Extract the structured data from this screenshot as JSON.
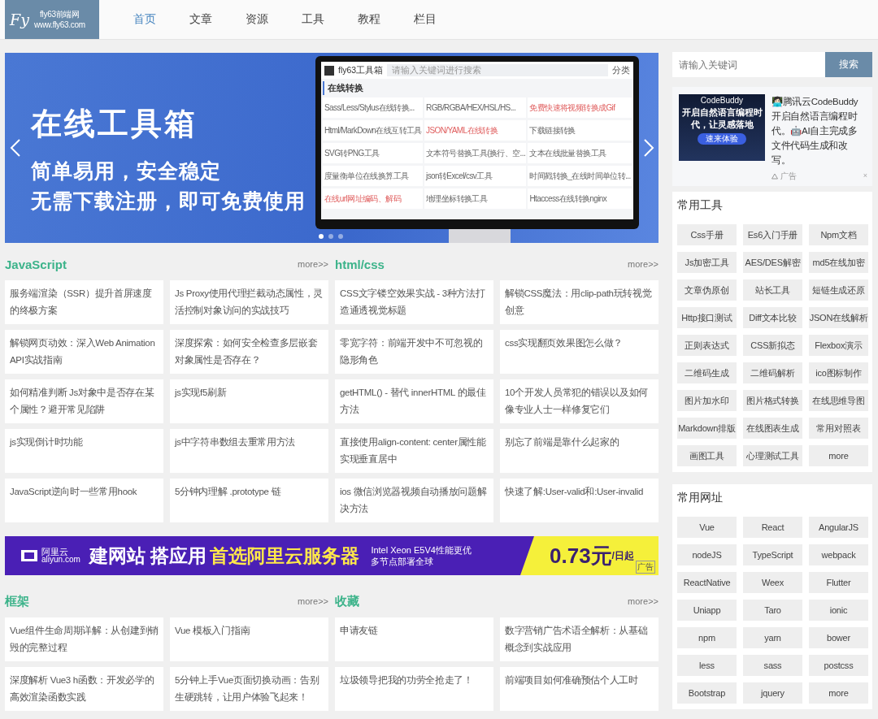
{
  "header": {
    "logo": {
      "mark": "Fy",
      "name": "fly63前端网",
      "url": "www.fly63.com"
    },
    "nav": [
      {
        "label": "首页",
        "selected": true
      },
      {
        "label": "文章",
        "selected": false
      },
      {
        "label": "资源",
        "selected": false
      },
      {
        "label": "工具",
        "selected": false
      },
      {
        "label": "教程",
        "selected": false
      },
      {
        "label": "栏目",
        "selected": false
      }
    ]
  },
  "banner": {
    "title": "在线工具箱",
    "lines": [
      "简单易用，安全稳定",
      "无需下载注册，即可免费使用"
    ],
    "screen": {
      "app_name": "fly63工具箱",
      "search_placeholder": "请输入关键词进行搜索",
      "category": "分类",
      "section": "在线转换",
      "items": [
        {
          "label": "Sass/Less/Stylus在线转换...",
          "hot": false
        },
        {
          "label": "RGB/RGBA/HEX/HSL/HS...",
          "hot": false
        },
        {
          "label": "免费快速将视频转换成Gif",
          "hot": true
        },
        {
          "label": "Html/MarkDown在线互转工具",
          "hot": false
        },
        {
          "label": "JSON/YAML在线转换",
          "hot": true
        },
        {
          "label": "下载链接转换",
          "hot": false
        },
        {
          "label": "SVG转PNG工具",
          "hot": false
        },
        {
          "label": "文本符号替换工具(换行、空...",
          "hot": false
        },
        {
          "label": "文本在线批量替换工具",
          "hot": false
        },
        {
          "label": "度量衡单位在线换算工具",
          "hot": false
        },
        {
          "label": "json转Excel/csv工具",
          "hot": false
        },
        {
          "label": "时间戳转换_在线时间单位转...",
          "hot": false
        },
        {
          "label": "在线url网址编码、解码",
          "hot": true
        },
        {
          "label": "地理坐标转换工具",
          "hot": false
        },
        {
          "label": "Htaccess在线转换nginx",
          "hot": false
        }
      ]
    },
    "dots": [
      {
        "selected": true
      },
      {
        "selected": false
      },
      {
        "selected": false
      }
    ]
  },
  "sections_top": [
    {
      "title": "JavaScript",
      "more": "more>>",
      "articles": [
        "服务端渲染（SSR）提升首屏速度的终极方案",
        "Js Proxy使用代理拦截动态属性，灵活控制对象访问的实战技巧",
        "解锁网页动效：深入Web Animation API实战指南",
        "深度探索：如何安全检查多层嵌套对象属性是否存在？",
        "如何精准判断 Js对象中是否存在某个属性？避开常见陷阱",
        "js实现f5刷新",
        "js实现倒计时功能",
        "js中字符串数组去重常用方法",
        "JavaScript逆向时一些常用hook",
        "5分钟内理解 .prototype 链"
      ]
    },
    {
      "title": "html/css",
      "more": "more>>",
      "articles": [
        "CSS文字镂空效果实战 - 3种方法打造通透视觉标题",
        "解锁CSS魔法：用clip-path玩转视觉创意",
        "零宽字符：前端开发中不可忽视的隐形角色",
        "css实现翻页效果图怎么做？",
        "getHTML() - 替代 innerHTML 的最佳方法",
        "10个开发人员常犯的错误以及如何像专业人士一样修复它们",
        "直接使用align-content: center属性能实现垂直居中",
        "别忘了前端是靠什么起家的",
        "ios 微信浏览器视频自动播放问题解决方法",
        "快速了解:User-valid和:User-invalid"
      ]
    }
  ],
  "ad_banner": {
    "brand": "阿里云",
    "domain": "aliyun.com",
    "headline": "建网站 搭应用",
    "headline_highlight": "首选阿里云服务器",
    "spec": "Intel Xeon E5V4性能更优",
    "spec2": "多节点部署全球",
    "price": "0.73元",
    "price_unit": "/日起",
    "tag": "广告"
  },
  "sections_bottom": [
    {
      "title": "框架",
      "more": "more>>",
      "articles": [
        "Vue组件生命周期详解：从创建到销毁的完整过程",
        "Vue 模板入门指南",
        "深度解析 Vue3 h函数：开发必学的高效渲染函数实践",
        "5分钟上手Vue页面切换动画：告别生硬跳转，让用户体验飞起来！"
      ]
    },
    {
      "title": "收藏",
      "more": "more>>",
      "articles": [
        "申请友链",
        "数字营销广告术语全解析：从基础概念到实战应用",
        "垃圾领导把我的功劳全抢走了！",
        "前端项目如何准确预估个人工时"
      ]
    }
  ],
  "sidebar": {
    "search": {
      "placeholder": "请输入关键词",
      "button": "搜索"
    },
    "ad": {
      "image_brand": "CodeBuddy",
      "image_text": "开启自然语言编程时代，让灵感落地",
      "image_button": "速来体验",
      "text": "👩🏻‍💻腾讯云CodeBuddy开启自然语言编程时代。🤖AI自主完成多文件代码生成和改写。",
      "label": "广告",
      "close": "×"
    },
    "tools": {
      "title": "常用工具",
      "items": [
        "Css手册",
        "Es6入门手册",
        "Npm文档",
        "Js加密工具",
        "AES/DES解密",
        "md5在线加密",
        "文章伪原创",
        "站长工具",
        "短链生成还原",
        "Http接口测试",
        "Diff文本比较",
        "JSON在线解析",
        "正则表达式",
        "CSS新拟态",
        "Flexbox演示",
        "二维码生成",
        "二维码解析",
        "ico图标制作",
        "图片加水印",
        "图片格式转换",
        "在线思维导图",
        "Markdown排版",
        "在线图表生成",
        "常用对照表",
        "画图工具",
        "心理测试工具",
        "more"
      ]
    },
    "links": {
      "title": "常用网址",
      "items": [
        "Vue",
        "React",
        "AngularJS",
        "nodeJS",
        "TypeScript",
        "webpack",
        "ReactNative",
        "Weex",
        "Flutter",
        "Uniapp",
        "Taro",
        "ionic",
        "npm",
        "yarn",
        "bower",
        "less",
        "sass",
        "postcss",
        "Bootstrap",
        "jquery",
        "more"
      ]
    }
  }
}
